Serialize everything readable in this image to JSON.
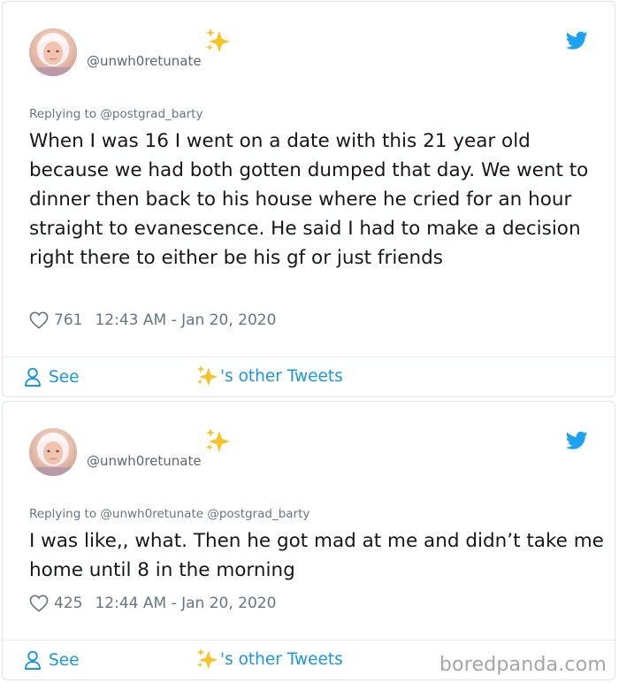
{
  "tweets": [
    {
      "handle": "@unwh0retunate",
      "reply_prefix": "Replying to",
      "reply_to": "@postgrad_barty",
      "text": "When I was 16 I went on a date with this 21 year old because we had both gotten dumped that day. We went to dinner then back to his house where he cried for an hour straight to evanescence. He said I had to make a decision right there to either be his gf or just friends",
      "likes": "761",
      "timestamp": "12:43 AM - Jan 20, 2020",
      "see_label": "See",
      "other_tweets_label": "'s other Tweets"
    },
    {
      "handle": "@unwh0retunate",
      "reply_prefix": "Replying to",
      "reply_to": "@unwh0retunate @postgrad_barty",
      "text": "I was like,, what. Then he got mad at me and didn’t take me home until 8 in the morning",
      "likes": "425",
      "timestamp": "12:44 AM - Jan 20, 2020",
      "see_label": "See",
      "other_tweets_label": "'s other Tweets"
    }
  ],
  "watermark": "boredpanda.com",
  "icons": {
    "avatar": "avatar",
    "display_name": "sparkles-icon",
    "platform": "twitter-bird-icon",
    "like": "heart-icon",
    "profile": "person-icon"
  },
  "colors": {
    "twitter_blue": "#1da1f2",
    "link_blue": "#1b95e0",
    "sparkle_yellow": "#f7c325",
    "muted": "#66757f"
  }
}
